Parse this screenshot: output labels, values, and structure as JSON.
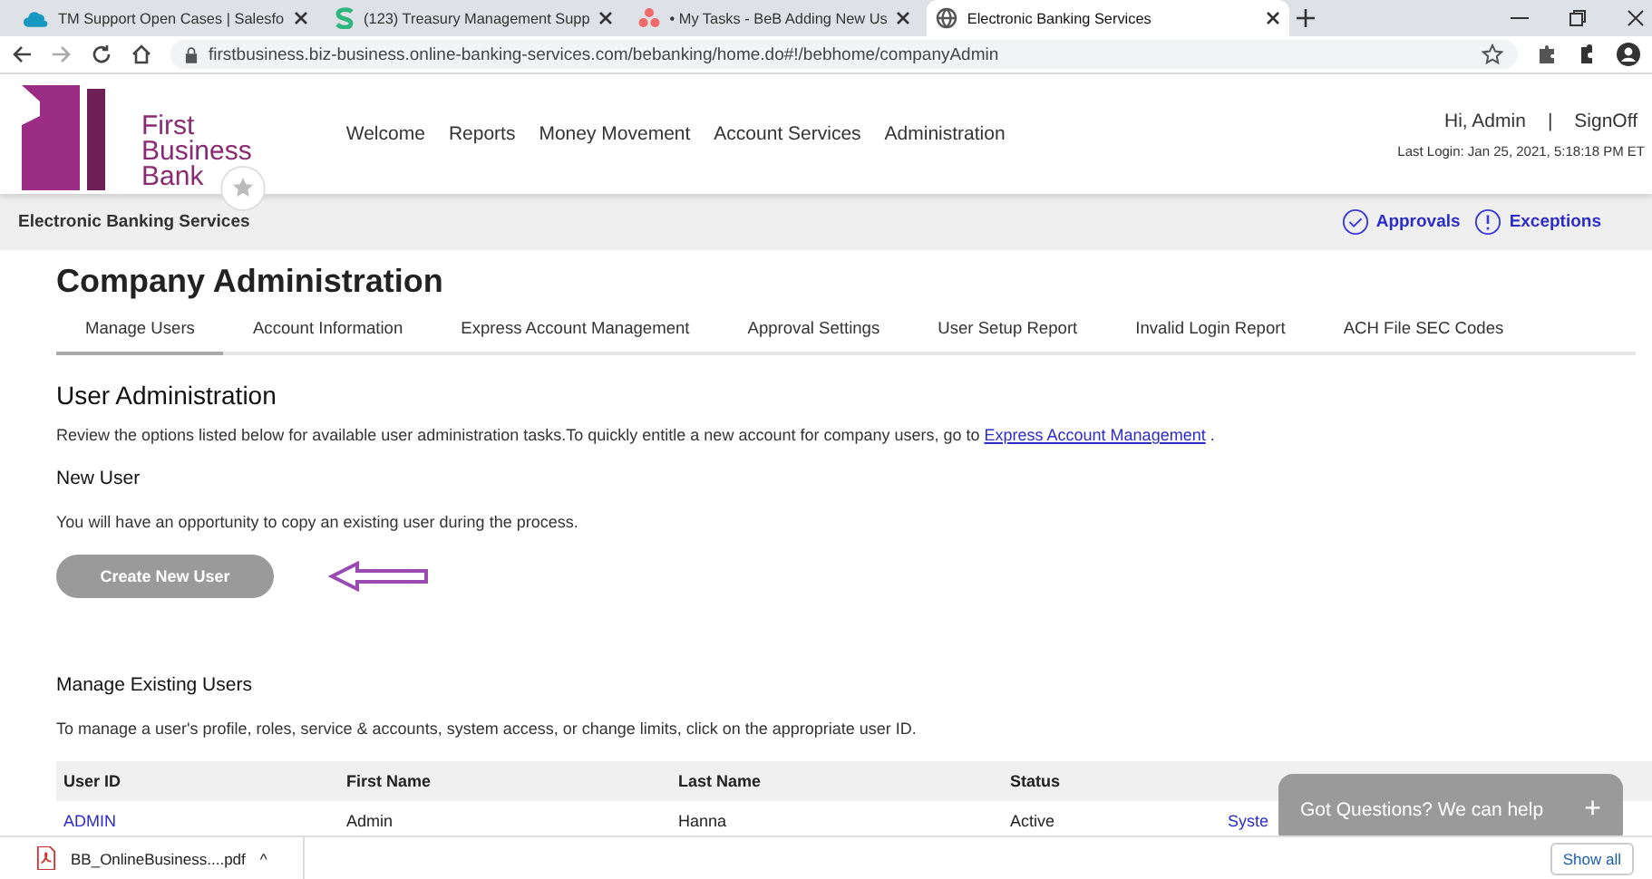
{
  "browser": {
    "tabs": [
      {
        "title": "TM Support Open Cases | Salesfo",
        "kind": "cloud",
        "selected": false
      },
      {
        "title": "(123) Treasury Management Supp",
        "kind": "s",
        "selected": false
      },
      {
        "title": "• My Tasks - BeB Adding New Us",
        "kind": "dots",
        "selected": false
      },
      {
        "title": "Electronic Banking Services",
        "kind": "globe",
        "selected": true
      }
    ],
    "url": "firstbusiness.biz-business.online-banking-services.com/bebanking/home.do#!/bebhome/companyAdmin"
  },
  "logo": {
    "lines": [
      "First",
      "Business",
      "Bank"
    ]
  },
  "nav": [
    "Welcome",
    "Reports",
    "Money Movement",
    "Account Services",
    "Administration"
  ],
  "user": {
    "greeting": "Hi, Admin",
    "separator": "|",
    "signoff": "SignOff",
    "last_login": "Last Login: Jan 25, 2021, 5:18:18 PM ET"
  },
  "band": {
    "title": "Electronic Banking Services",
    "links": [
      {
        "label": "Approvals",
        "kind": "check"
      },
      {
        "label": "Exceptions",
        "kind": "alert"
      }
    ]
  },
  "page_title": "Company Administration",
  "tabs": [
    {
      "label": "Manage Users",
      "selected": true
    },
    {
      "label": "Account Information",
      "selected": false
    },
    {
      "label": "Express Account Management",
      "selected": false
    },
    {
      "label": "Approval Settings",
      "selected": false
    },
    {
      "label": "User Setup Report",
      "selected": false
    },
    {
      "label": "Invalid Login Report",
      "selected": false
    },
    {
      "label": "ACH File SEC Codes",
      "selected": false
    }
  ],
  "section_title": "User Administration",
  "intro": {
    "text": "Review the options listed below for available user administration tasks.To quickly entitle a new account for company users, go to",
    "link": "Express Account Management",
    "after": "."
  },
  "new_user": {
    "heading": "New User",
    "text": "You will have an opportunity to copy an existing user during the process.",
    "button": "Create New User"
  },
  "existing": {
    "heading": "Manage Existing Users",
    "text": "To manage a user's profile, roles, service & accounts, system access, or change limits, click on the appropriate user ID."
  },
  "table": {
    "columns": [
      "User ID",
      "First Name",
      "Last Name",
      "Status"
    ],
    "rows": [
      [
        "ADMIN",
        "Admin",
        "Hanna",
        "Active",
        "Syste"
      ]
    ]
  },
  "chat": {
    "text": "Got Questions? We can help",
    "plus": "+"
  },
  "downloads": {
    "file": "BB_OnlineBusiness....pdf",
    "caret": "^",
    "show_all": "Show all"
  }
}
